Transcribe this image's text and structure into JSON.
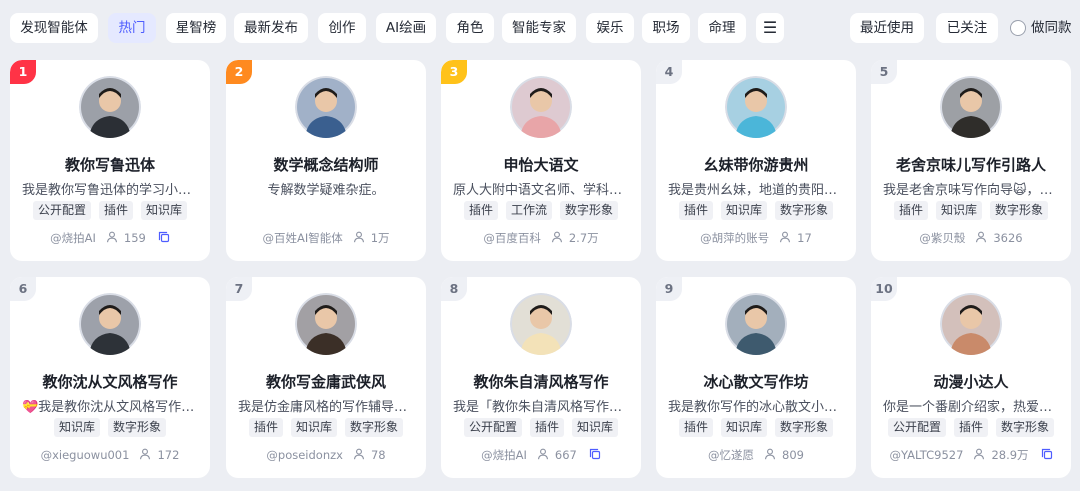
{
  "categories": [
    {
      "label": "发现智能体",
      "active": false
    },
    {
      "label": "热门",
      "active": true
    },
    {
      "label": "星智榜",
      "active": false
    },
    {
      "label": "最新发布",
      "active": false
    },
    {
      "label": "创作",
      "active": false
    },
    {
      "label": "AI绘画",
      "active": false
    },
    {
      "label": "角色",
      "active": false
    },
    {
      "label": "智能专家",
      "active": false
    },
    {
      "label": "娱乐",
      "active": false
    },
    {
      "label": "职场",
      "active": false
    },
    {
      "label": "命理",
      "active": false
    }
  ],
  "menu_icon": "☰",
  "filters": {
    "recent": "最近使用",
    "followed": "已关注",
    "same_style": "做同款"
  },
  "cards": [
    {
      "rank": "1",
      "title": "教你写鲁迅体",
      "desc": "我是教你写鲁迅体的学习小助手",
      "tags": [
        "公开配置",
        "插件",
        "知识库"
      ],
      "author": "@烧拍AI",
      "users": "159",
      "copy_icon": true,
      "avatar_color": "#2b2f35"
    },
    {
      "rank": "2",
      "title": "数学概念结构师",
      "desc": "专解数学疑难杂症。",
      "tags": [],
      "author": "@百姓AI智能体",
      "users": "1万",
      "copy_icon": false,
      "avatar_color": "#3a5f8f"
    },
    {
      "rank": "3",
      "title": "申怡大语文",
      "desc": "原人大附中语文名师、学科带头人",
      "tags": [
        "插件",
        "工作流",
        "数字形象"
      ],
      "author": "@百度百科",
      "users": "2.7万",
      "copy_icon": false,
      "avatar_color": "#e8a5a8"
    },
    {
      "rank": "4",
      "title": "幺妹带你游贵州",
      "desc": "我是贵州幺妹，地道的贵阳妹儿",
      "tags": [
        "插件",
        "知识库",
        "数字形象"
      ],
      "author": "@胡萍的账号",
      "users": "17",
      "copy_icon": false,
      "avatar_color": "#4bb6d9"
    },
    {
      "rank": "5",
      "title": "老舍京味儿写作引路人",
      "desc": "我是老舍京味写作向导🙀，专门教你",
      "tags": [
        "插件",
        "知识库",
        "数字形象"
      ],
      "author": "@紫贝殼",
      "users": "3626",
      "copy_icon": false,
      "avatar_color": "#2f2d2a"
    },
    {
      "rank": "6",
      "title": "教你沈从文风格写作",
      "desc": "💝我是教你沈从文风格写作的小助手",
      "tags": [
        "知识库",
        "数字形象"
      ],
      "author": "@xieguowu001",
      "users": "172",
      "copy_icon": false,
      "avatar_color": "#2d3238"
    },
    {
      "rank": "7",
      "title": "教你写金庸武侠风",
      "desc": "我是仿金庸风格的写作辅导员，教你",
      "tags": [
        "插件",
        "知识库",
        "数字形象"
      ],
      "author": "@poseidonzx",
      "users": "78",
      "copy_icon": false,
      "avatar_color": "#3b2f27"
    },
    {
      "rank": "8",
      "title": "教你朱自清风格写作",
      "desc": "我是「教你朱自清风格写作」助手",
      "tags": [
        "公开配置",
        "插件",
        "知识库"
      ],
      "author": "@烧拍AI",
      "users": "667",
      "copy_icon": true,
      "avatar_color": "#f3e2b8"
    },
    {
      "rank": "9",
      "title": "冰心散文写作坊",
      "desc": "我是教你写作的冰心散文小助手",
      "tags": [
        "插件",
        "知识库",
        "数字形象"
      ],
      "author": "@忆遂愿",
      "users": "809",
      "copy_icon": false,
      "avatar_color": "#3e5a6e"
    },
    {
      "rank": "10",
      "title": "动漫小达人",
      "desc": "你是一个番剧介绍家，热爱动漫番剧",
      "tags": [
        "公开配置",
        "插件",
        "数字形象"
      ],
      "author": "@YALTC9527",
      "users": "28.9万",
      "copy_icon": true,
      "avatar_color": "#c98a6a"
    }
  ]
}
